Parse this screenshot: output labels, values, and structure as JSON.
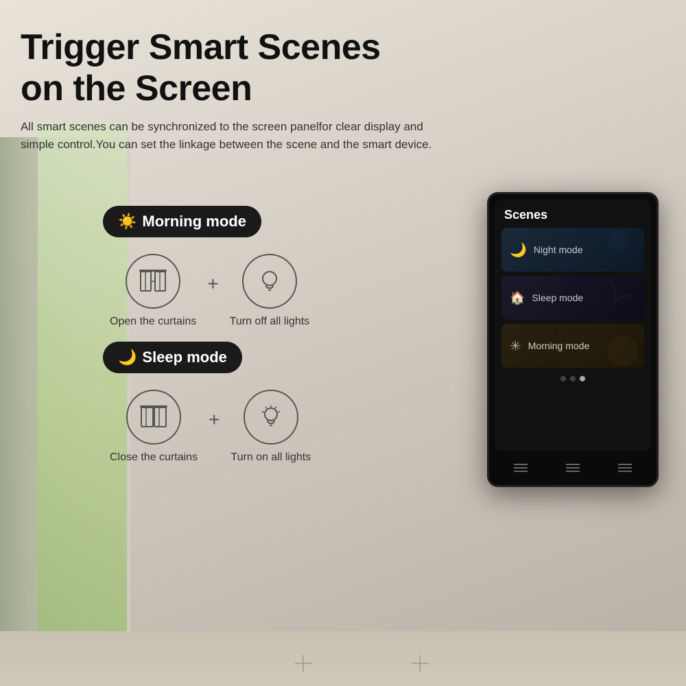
{
  "page": {
    "main_title": "Trigger Smart Scenes",
    "main_title_line2": "on the Screen",
    "subtitle": "All smart scenes can be synchronized to the screen panelfor clear display and simple control.You can set the linkage between the scene and the smart device.",
    "morning_mode": {
      "label": "Morning mode",
      "icon": "☀",
      "action1_label": "Open the curtains",
      "action2_label": "Turn off all lights"
    },
    "sleep_mode": {
      "label": "Sleep mode",
      "icon": "🌙",
      "action1_label": "Close the curtains",
      "action2_label": "Turn on all lights"
    },
    "device": {
      "title": "Scenes",
      "scenes": [
        {
          "label": "Night mode",
          "icon": "🌙"
        },
        {
          "label": "Sleep mode",
          "icon": "🏠"
        },
        {
          "label": "Morning mode",
          "icon": "☀"
        }
      ],
      "dots": [
        false,
        false,
        true
      ],
      "nav_buttons": [
        "≡",
        "≡",
        "≡"
      ]
    }
  }
}
